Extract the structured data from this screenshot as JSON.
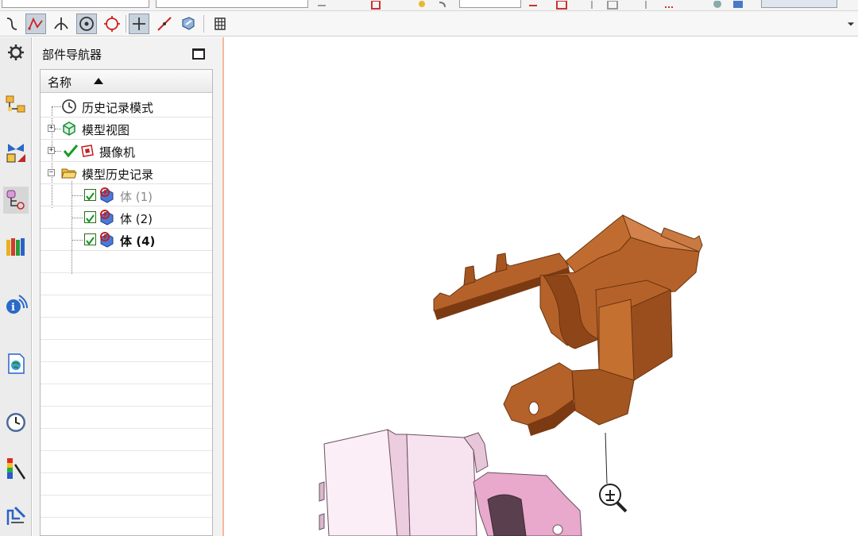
{
  "navigator": {
    "title": "部件导航器",
    "column_header": "名称",
    "items": [
      {
        "label": "历史记录模式",
        "icon": "clock-icon"
      },
      {
        "label": "模型视图",
        "icon": "model-view-icon",
        "expandable": true
      },
      {
        "label": "摄像机",
        "icon": "camera-icon",
        "expandable": true
      },
      {
        "label": "模型历史记录",
        "icon": "folder-open-icon",
        "expandable": true,
        "expanded": true
      },
      {
        "label": "体 (1)",
        "icon": "body-icon",
        "checked": true,
        "dimmed": true
      },
      {
        "label": "体 (2)",
        "icon": "body-icon",
        "checked": true
      },
      {
        "label": "体 (4)",
        "icon": "body-icon",
        "checked": true,
        "bold": true
      }
    ]
  },
  "snap_toolbar": {
    "buttons": [
      "curve-snap-icon",
      "endpoint-snap-icon",
      "intersection-snap-icon",
      "arc-center-snap-icon",
      "quadrant-snap-icon",
      "point-on-curve-icon",
      "point-on-face-icon",
      "bounded-grid-icon",
      "grid-table-icon"
    ],
    "active": [
      "endpoint-snap-icon",
      "arc-center-snap-icon",
      "point-on-curve-icon"
    ]
  },
  "resource_bar": {
    "icons": [
      "settings-gear-icon",
      "assembly-navigator-icon",
      "constraint-navigator-icon",
      "part-navigator-icon",
      "reuse-library-icon",
      "hd3d-tools-icon",
      "web-browser-icon",
      "history-icon",
      "system-materials-icon",
      "process-studio-icon"
    ]
  },
  "colors": {
    "accent_border": "#f5b89a",
    "part_brown": "#b5622a",
    "part_pink": "#f2d3e8",
    "part_pink_dark": "#e0a6c8"
  }
}
